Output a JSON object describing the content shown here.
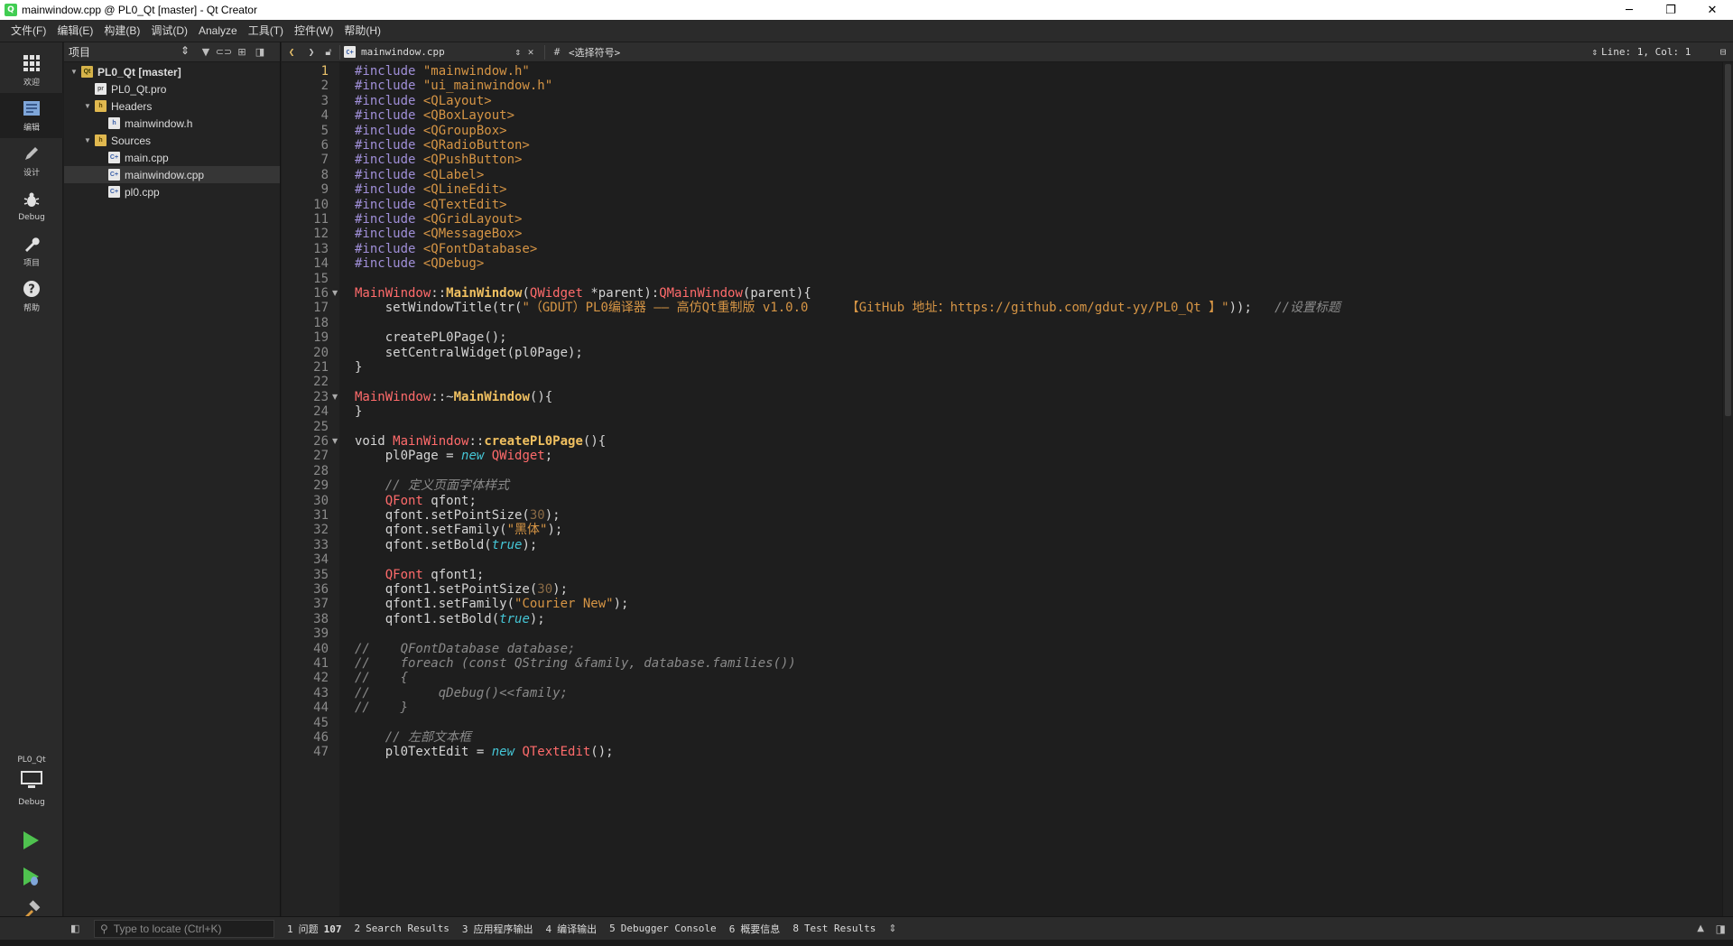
{
  "window": {
    "title": "mainwindow.cpp @ PL0_Qt [master] - Qt Creator",
    "minimize": "─",
    "restore": "❐",
    "close": "✕"
  },
  "menu": [
    "文件(F)",
    "编辑(E)",
    "构建(B)",
    "调试(D)",
    "Analyze",
    "工具(T)",
    "控件(W)",
    "帮助(H)"
  ],
  "modes": [
    {
      "label": "欢迎",
      "icon": "welcome-grid-icon"
    },
    {
      "label": "编辑",
      "icon": "edit-doc-icon",
      "active": true
    },
    {
      "label": "设计",
      "icon": "design-pencil-icon"
    },
    {
      "label": "Debug",
      "icon": "debug-bug-icon"
    },
    {
      "label": "项目",
      "icon": "projects-wrench-icon"
    },
    {
      "label": "帮助",
      "icon": "help-icon"
    }
  ],
  "kit": {
    "project": "PL0_Qt",
    "config": "Debug"
  },
  "nav": {
    "selector": "项目",
    "tree": [
      {
        "label": "PL0_Qt [master]",
        "type": "proj",
        "depth": 0,
        "expanded": true,
        "bold": true
      },
      {
        "label": "PL0_Qt.pro",
        "type": "pro",
        "depth": 1
      },
      {
        "label": "Headers",
        "type": "folder",
        "depth": 1,
        "expanded": true
      },
      {
        "label": "mainwindow.h",
        "type": "hfile",
        "depth": 2
      },
      {
        "label": "Sources",
        "type": "folder",
        "depth": 1,
        "expanded": true
      },
      {
        "label": "main.cpp",
        "type": "cfile",
        "depth": 2
      },
      {
        "label": "mainwindow.cpp",
        "type": "cfile",
        "depth": 2,
        "selected": true
      },
      {
        "label": "pl0.cpp",
        "type": "cfile",
        "depth": 2
      }
    ]
  },
  "editor_toolbar": {
    "file": "mainwindow.cpp",
    "symbol_hash": "#",
    "symbol": "<选择符号>",
    "position": "Line: 1, Col: 1"
  },
  "editor": {
    "current_line": 1,
    "fold_lines": [
      16,
      23,
      26
    ],
    "lines": [
      [
        [
          "#include ",
          "#a08fd8"
        ],
        [
          "\"mainwindow.h\"",
          "#d69545"
        ]
      ],
      [
        [
          "#include ",
          "#a08fd8"
        ],
        [
          "\"ui_mainwindow.h\"",
          "#d69545"
        ]
      ],
      [
        [
          "#include ",
          "#a08fd8"
        ],
        [
          "<QLayout>",
          "#d69545"
        ]
      ],
      [
        [
          "#include ",
          "#a08fd8"
        ],
        [
          "<QBoxLayout>",
          "#d69545"
        ]
      ],
      [
        [
          "#include ",
          "#a08fd8"
        ],
        [
          "<QGroupBox>",
          "#d69545"
        ]
      ],
      [
        [
          "#include ",
          "#a08fd8"
        ],
        [
          "<QRadioButton>",
          "#d69545"
        ]
      ],
      [
        [
          "#include ",
          "#a08fd8"
        ],
        [
          "<QPushButton>",
          "#d69545"
        ]
      ],
      [
        [
          "#include ",
          "#a08fd8"
        ],
        [
          "<QLabel>",
          "#d69545"
        ]
      ],
      [
        [
          "#include ",
          "#a08fd8"
        ],
        [
          "<QLineEdit>",
          "#d69545"
        ]
      ],
      [
        [
          "#include ",
          "#a08fd8"
        ],
        [
          "<QTextEdit>",
          "#d69545"
        ]
      ],
      [
        [
          "#include ",
          "#a08fd8"
        ],
        [
          "<QGridLayout>",
          "#d69545"
        ]
      ],
      [
        [
          "#include ",
          "#a08fd8"
        ],
        [
          "<QMessageBox>",
          "#d69545"
        ]
      ],
      [
        [
          "#include ",
          "#a08fd8"
        ],
        [
          "<QFontDatabase>",
          "#d69545"
        ]
      ],
      [
        [
          "#include ",
          "#a08fd8"
        ],
        [
          "<QDebug>",
          "#d69545"
        ]
      ],
      [],
      [
        [
          "MainWindow",
          "#ff6b6b"
        ],
        [
          "::",
          "#d4d4d4"
        ],
        [
          "MainWindow",
          "#f0c060"
        ],
        [
          "(",
          "#d4d4d4"
        ],
        [
          "QWidget",
          "#ff6b6b"
        ],
        [
          " *parent):",
          "#d4d4d4"
        ],
        [
          "QMainWindow",
          "#ff6b6b"
        ],
        [
          "(parent){",
          "#d4d4d4"
        ]
      ],
      [
        [
          "    setWindowTitle(tr(",
          "#d4d4d4"
        ],
        [
          "\"（GDUT）PL0编译器 —— 高仿Qt重制版 v1.0.0     【GitHub 地址：https://github.com/gdut-yy/PL0_Qt 】\"",
          "#d69545"
        ],
        [
          "));   ",
          "#d4d4d4"
        ],
        [
          "//设置标题",
          "#8a8a8a"
        ]
      ],
      [],
      [
        [
          "    createPL0Page();",
          "#d4d4d4"
        ]
      ],
      [
        [
          "    setCentralWidget(pl0Page);",
          "#d4d4d4"
        ]
      ],
      [
        [
          "}",
          "#d4d4d4"
        ]
      ],
      [],
      [
        [
          "MainWindow",
          "#ff6b6b"
        ],
        [
          "::~",
          "#d4d4d4"
        ],
        [
          "MainWindow",
          "#f0c060"
        ],
        [
          "(){",
          "#d4d4d4"
        ]
      ],
      [
        [
          "}",
          "#d4d4d4"
        ]
      ],
      [],
      [
        [
          "void ",
          "#d4d4d4"
        ],
        [
          "MainWindow",
          "#ff6b6b"
        ],
        [
          "::",
          "#d4d4d4"
        ],
        [
          "createPL0Page",
          "#f0c060"
        ],
        [
          "(){",
          "#d4d4d4"
        ]
      ],
      [
        [
          "    pl0Page = ",
          "#d4d4d4"
        ],
        [
          "new ",
          "#45c6d6"
        ],
        [
          "QWidget",
          "#ff6b6b"
        ],
        [
          ";",
          "#d4d4d4"
        ]
      ],
      [],
      [
        [
          "    // 定义页面字体样式",
          "#8a8a8a"
        ]
      ],
      [
        [
          "    ",
          "#d4d4d4"
        ],
        [
          "QFont",
          "#ff6b6b"
        ],
        [
          " qfont;",
          "#d4d4d4"
        ]
      ],
      [
        [
          "    qfont.setPointSize(",
          "#d4d4d4"
        ],
        [
          "30",
          "#8a6a45"
        ],
        [
          ");",
          "#d4d4d4"
        ]
      ],
      [
        [
          "    qfont.setFamily(",
          "#d4d4d4"
        ],
        [
          "\"黑体\"",
          "#d69545"
        ],
        [
          ");",
          "#d4d4d4"
        ]
      ],
      [
        [
          "    qfont.setBold(",
          "#d4d4d4"
        ],
        [
          "true",
          "#45c6d6"
        ],
        [
          ");",
          "#d4d4d4"
        ]
      ],
      [],
      [
        [
          "    ",
          "#d4d4d4"
        ],
        [
          "QFont",
          "#ff6b6b"
        ],
        [
          " qfont1;",
          "#d4d4d4"
        ]
      ],
      [
        [
          "    qfont1.setPointSize(",
          "#d4d4d4"
        ],
        [
          "30",
          "#8a6a45"
        ],
        [
          ");",
          "#d4d4d4"
        ]
      ],
      [
        [
          "    qfont1.setFamily(",
          "#d4d4d4"
        ],
        [
          "\"Courier New\"",
          "#d69545"
        ],
        [
          ");",
          "#d4d4d4"
        ]
      ],
      [
        [
          "    qfont1.setBold(",
          "#d4d4d4"
        ],
        [
          "true",
          "#45c6d6"
        ],
        [
          ");",
          "#d4d4d4"
        ]
      ],
      [],
      [
        [
          "//    QFontDatabase database;",
          "#8a8a8a"
        ]
      ],
      [
        [
          "//    foreach (const QString &family, database.families())",
          "#8a8a8a"
        ]
      ],
      [
        [
          "//    {",
          "#8a8a8a"
        ]
      ],
      [
        [
          "//         qDebug()<<family;",
          "#8a8a8a"
        ]
      ],
      [
        [
          "//    }",
          "#8a8a8a"
        ]
      ],
      [],
      [
        [
          "    // 左部文本框",
          "#8a8a8a"
        ]
      ],
      [
        [
          "    pl0TextEdit = ",
          "#d4d4d4"
        ],
        [
          "new ",
          "#45c6d6"
        ],
        [
          "QTextEdit",
          "#ff6b6b"
        ],
        [
          "();",
          "#d4d4d4"
        ]
      ]
    ]
  },
  "status": {
    "locate_placeholder": "Type to locate (Ctrl+K)",
    "tabs": [
      {
        "num": "1",
        "label": "问题",
        "badge": "107"
      },
      {
        "num": "2",
        "label": "Search Results"
      },
      {
        "num": "3",
        "label": "应用程序输出"
      },
      {
        "num": "4",
        "label": "编译输出"
      },
      {
        "num": "5",
        "label": "Debugger Console"
      },
      {
        "num": "6",
        "label": "概要信息"
      },
      {
        "num": "8",
        "label": "Test Results"
      }
    ]
  }
}
